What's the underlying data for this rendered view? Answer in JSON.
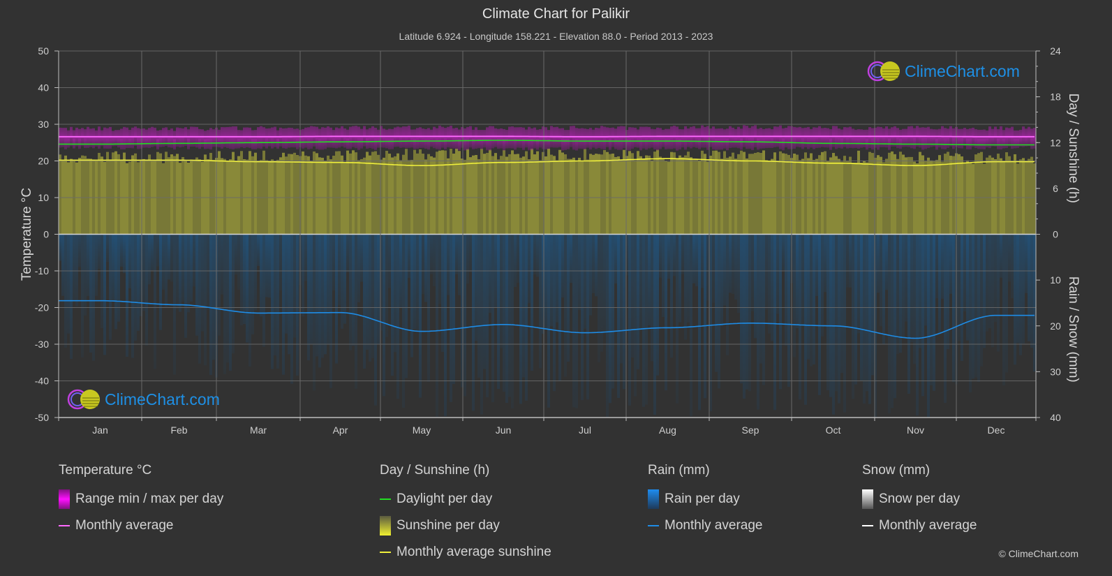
{
  "header": {
    "title": "Climate Chart for Palikir",
    "subtitle": "Latitude 6.924 - Longitude 158.221 - Elevation 88.0 - Period 2013 - 2023"
  },
  "logo": {
    "text": "ClimeChart.com"
  },
  "copyright": "© ClimeChart.com",
  "colors": {
    "background": "#323232",
    "temp_range": "#c81ec8",
    "temp_avg": "#ff6aff",
    "daylight": "#22dd22",
    "sunshine_fill": "#9a9a3a",
    "sunshine_avg": "#f0f03c",
    "rain_fill": "#1e5a8c",
    "rain_avg": "#1e8ce6",
    "snow_avg": "#ffffff",
    "logo_text": "#1e90e6"
  },
  "legend": {
    "temperature": {
      "title": "Temperature °C",
      "items": [
        "Range min / max per day",
        "Monthly average"
      ]
    },
    "sunshine": {
      "title": "Day / Sunshine (h)",
      "items": [
        "Daylight per day",
        "Sunshine per day",
        "Monthly average sunshine"
      ]
    },
    "rain": {
      "title": "Rain (mm)",
      "items": [
        "Rain per day",
        "Monthly average"
      ]
    },
    "snow": {
      "title": "Snow (mm)",
      "items": [
        "Snow per day",
        "Monthly average"
      ]
    }
  },
  "chart_data": {
    "type": "line",
    "title": "Climate Chart for Palikir",
    "categories": [
      "Jan",
      "Feb",
      "Mar",
      "Apr",
      "May",
      "Jun",
      "Jul",
      "Aug",
      "Sep",
      "Oct",
      "Nov",
      "Dec"
    ],
    "left_axis": {
      "label": "Temperature °C",
      "range": [
        -50,
        50
      ],
      "ticks": [
        50,
        40,
        30,
        20,
        10,
        0,
        -10,
        -20,
        -30,
        -40,
        -50
      ]
    },
    "right_axis_top": {
      "label": "Day / Sunshine (h)",
      "range": [
        0,
        24
      ],
      "ticks": [
        24,
        18,
        12,
        6,
        0
      ]
    },
    "right_axis_bottom": {
      "label": "Rain / Snow (mm)",
      "range": [
        0,
        40
      ],
      "ticks": [
        10,
        20,
        30,
        40
      ]
    },
    "grid": true,
    "series": [
      {
        "name": "Temperature range max",
        "axis": "temperature",
        "values": [
          28.8,
          28.8,
          28.9,
          29.0,
          29.1,
          29.0,
          29.0,
          29.1,
          29.2,
          29.1,
          29.0,
          28.9
        ]
      },
      {
        "name": "Temperature range min",
        "axis": "temperature",
        "values": [
          23.6,
          23.6,
          23.6,
          23.5,
          23.4,
          23.3,
          23.3,
          23.3,
          23.3,
          23.4,
          23.5,
          23.6
        ]
      },
      {
        "name": "Temperature monthly average",
        "axis": "temperature",
        "values": [
          26.6,
          26.6,
          26.6,
          26.7,
          26.7,
          26.7,
          26.6,
          26.7,
          26.7,
          26.7,
          26.7,
          26.6
        ]
      },
      {
        "name": "Daylight per day",
        "axis": "sunshine",
        "values": [
          11.8,
          11.9,
          12.0,
          12.1,
          12.2,
          12.3,
          12.2,
          12.2,
          12.1,
          11.9,
          11.8,
          11.7
        ]
      },
      {
        "name": "Sunshine per day (max band)",
        "axis": "sunshine",
        "values": [
          10.9,
          10.9,
          11.0,
          11.0,
          11.2,
          11.2,
          11.2,
          11.1,
          11.0,
          11.0,
          10.8,
          10.8
        ]
      },
      {
        "name": "Monthly average sunshine",
        "axis": "sunshine",
        "values": [
          9.7,
          9.7,
          9.5,
          9.4,
          9.0,
          9.4,
          9.6,
          9.9,
          9.6,
          9.3,
          9.0,
          9.5
        ]
      },
      {
        "name": "Rain monthly average",
        "axis": "rain",
        "values": [
          14.5,
          15.4,
          17.2,
          17.1,
          21.2,
          19.7,
          21.5,
          20.4,
          19.4,
          20.0,
          22.7,
          17.7
        ]
      },
      {
        "name": "Snow monthly average",
        "axis": "rain",
        "values": [
          0,
          0,
          0,
          0,
          0,
          0,
          0,
          0,
          0,
          0,
          0,
          0
        ]
      }
    ]
  }
}
